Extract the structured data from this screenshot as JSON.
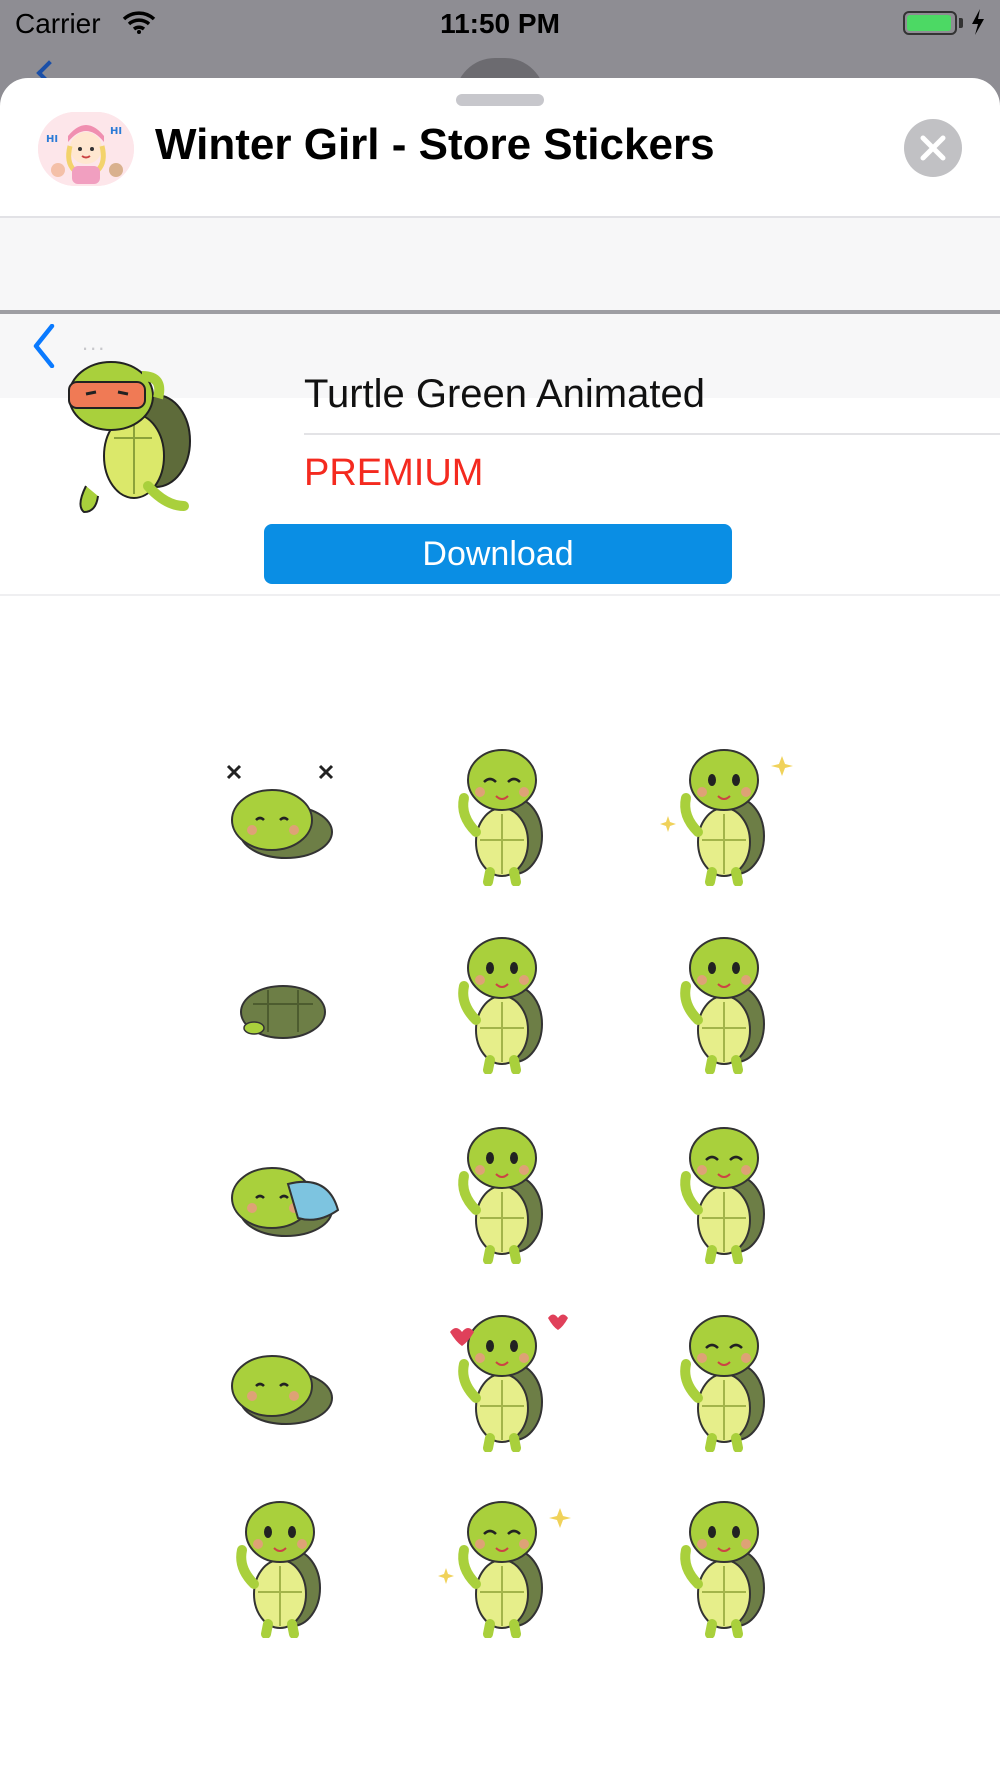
{
  "status_bar": {
    "carrier": "Carrier",
    "time": "11:50 PM",
    "battery_level": 1.0
  },
  "header": {
    "app_title": "Winter Girl - Store Stickers",
    "app_icon": "winter-girl-app-icon",
    "close_icon": "close-icon"
  },
  "nav": {
    "back_icon": "chevron-left-icon",
    "dots": "..."
  },
  "pack": {
    "title": "Turtle Green Animated",
    "status": "PREMIUM",
    "download_label": "Download",
    "status_color": "#f42a1f",
    "button_color": "#0a8ee4"
  },
  "stickers": [
    "turtle-flipped-dizzy",
    "turtle-hands-on-head",
    "turtle-sparkle-wave",
    "turtle-hiding-in-shell",
    "turtle-back-view",
    "turtle-thinking",
    "turtle-sleeping-blanket",
    "turtle-peace-sign",
    "turtle-sleepy-standing",
    "turtle-peeking-shell",
    "turtle-love-hearts",
    "turtle-shrug",
    "turtle-sweating-laugh",
    "turtle-happy-jump",
    "turtle-shouting"
  ]
}
